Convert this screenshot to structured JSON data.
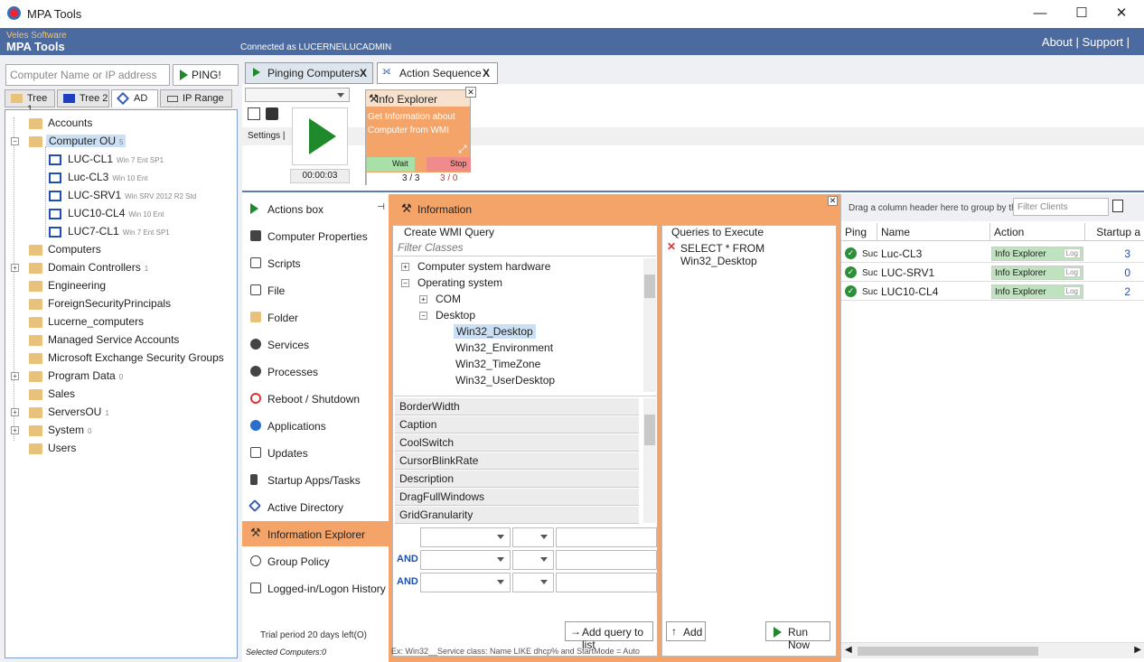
{
  "window": {
    "title": "MPA Tools",
    "min": "—",
    "max": "☐",
    "close": "✕"
  },
  "banner": {
    "subtitle": "Veles Software",
    "app_name": "MPA Tools",
    "connected": "Connected as LUCERNE\\LUCADMIN",
    "links": "About | Support |"
  },
  "left": {
    "computer_input_placeholder": "Computer Name or IP address",
    "ping_label": "PING!",
    "tabs": [
      "Tree 1",
      "Tree 2",
      "AD",
      "IP Range"
    ],
    "tree": [
      {
        "label": "Accounts",
        "note": ""
      },
      {
        "label": "Computer OU",
        "note": "5"
      },
      {
        "label": "LUC-CL1",
        "note": "Win 7 Ent SP1"
      },
      {
        "label": "Luc-CL3",
        "note": "Win 10 Ent"
      },
      {
        "label": "LUC-SRV1",
        "note": "Win SRV 2012 R2 Std"
      },
      {
        "label": "LUC10-CL4",
        "note": "Win 10 Ent"
      },
      {
        "label": "LUC7-CL1",
        "note": "Win 7 Ent SP1"
      },
      {
        "label": "Computers",
        "note": ""
      },
      {
        "label": "Domain Controllers",
        "note": "1"
      },
      {
        "label": "Engineering",
        "note": ""
      },
      {
        "label": "ForeignSecurityPrincipals",
        "note": ""
      },
      {
        "label": "Lucerne_computers",
        "note": ""
      },
      {
        "label": "Managed Service Accounts",
        "note": ""
      },
      {
        "label": "Microsoft Exchange Security Groups",
        "note": ""
      },
      {
        "label": "Program Data",
        "note": "0"
      },
      {
        "label": "Sales",
        "note": ""
      },
      {
        "label": "ServersOU",
        "note": "1"
      },
      {
        "label": "System",
        "note": "0"
      },
      {
        "label": "Users",
        "note": ""
      }
    ]
  },
  "tabs": {
    "pinging": "Pinging Computers",
    "action_seq": "Action Sequence",
    "close": "X"
  },
  "sequence": {
    "settings": "Settings |",
    "timer": "00:00:03",
    "card_title": "Info Explorer",
    "card_desc": "Get Information about Computer from WMI",
    "wait": "Wait",
    "stop": "Stop",
    "count_done": "3 / 3",
    "count_err": "3 / 0"
  },
  "actions": [
    "Actions box",
    "Computer Properties",
    "Scripts",
    "File",
    "Folder",
    "Services",
    "Processes",
    "Reboot / Shutdown",
    "Applications",
    "Updates",
    "Startup Apps/Tasks",
    "Active Directory",
    "Information Explorer",
    "Group Policy",
    "Logged-in/Logon History"
  ],
  "trial": "Trial period 20 days left(O)",
  "selected": "Selected Computers:0",
  "info": {
    "header": "Information",
    "create_title": "Create WMI Query",
    "filter_placeholder": "Filter Classes",
    "classes": [
      "Computer system hardware",
      "Operating system",
      "COM",
      "Desktop",
      "Win32_Desktop",
      "Win32_Environment",
      "Win32_TimeZone",
      "Win32_UserDesktop"
    ],
    "properties": [
      "BorderWidth",
      "Caption",
      "CoolSwitch",
      "CursorBlinkRate",
      "Description",
      "DragFullWindows",
      "GridGranularity"
    ],
    "and1": "AND",
    "and2": "AND",
    "add_query": "Add query to list",
    "queries_title": "Queries to Execute",
    "query": "SELECT * FROM Win32_Desktop",
    "add": "Add",
    "run_now": "Run Now",
    "example": "Ex:  Win32__Service class: Name LIKE dhcp% and StartMode = Auto"
  },
  "grid": {
    "group_hint": "Drag a column header here to group by tha",
    "filter_placeholder": "Filter Clients",
    "headers": [
      "Ping",
      "Name",
      "Action",
      "Startup a"
    ],
    "rows": [
      {
        "ping": "Suc",
        "name": "Luc-CL3",
        "action": "Info Explorer",
        "log": "Log",
        "startup": "3"
      },
      {
        "ping": "Suc",
        "name": "LUC-SRV1",
        "action": "Info Explorer",
        "log": "Log",
        "startup": "0"
      },
      {
        "ping": "Suc",
        "name": "LUC10-CL4",
        "action": "Info Explorer",
        "log": "Log",
        "startup": "2"
      }
    ]
  }
}
